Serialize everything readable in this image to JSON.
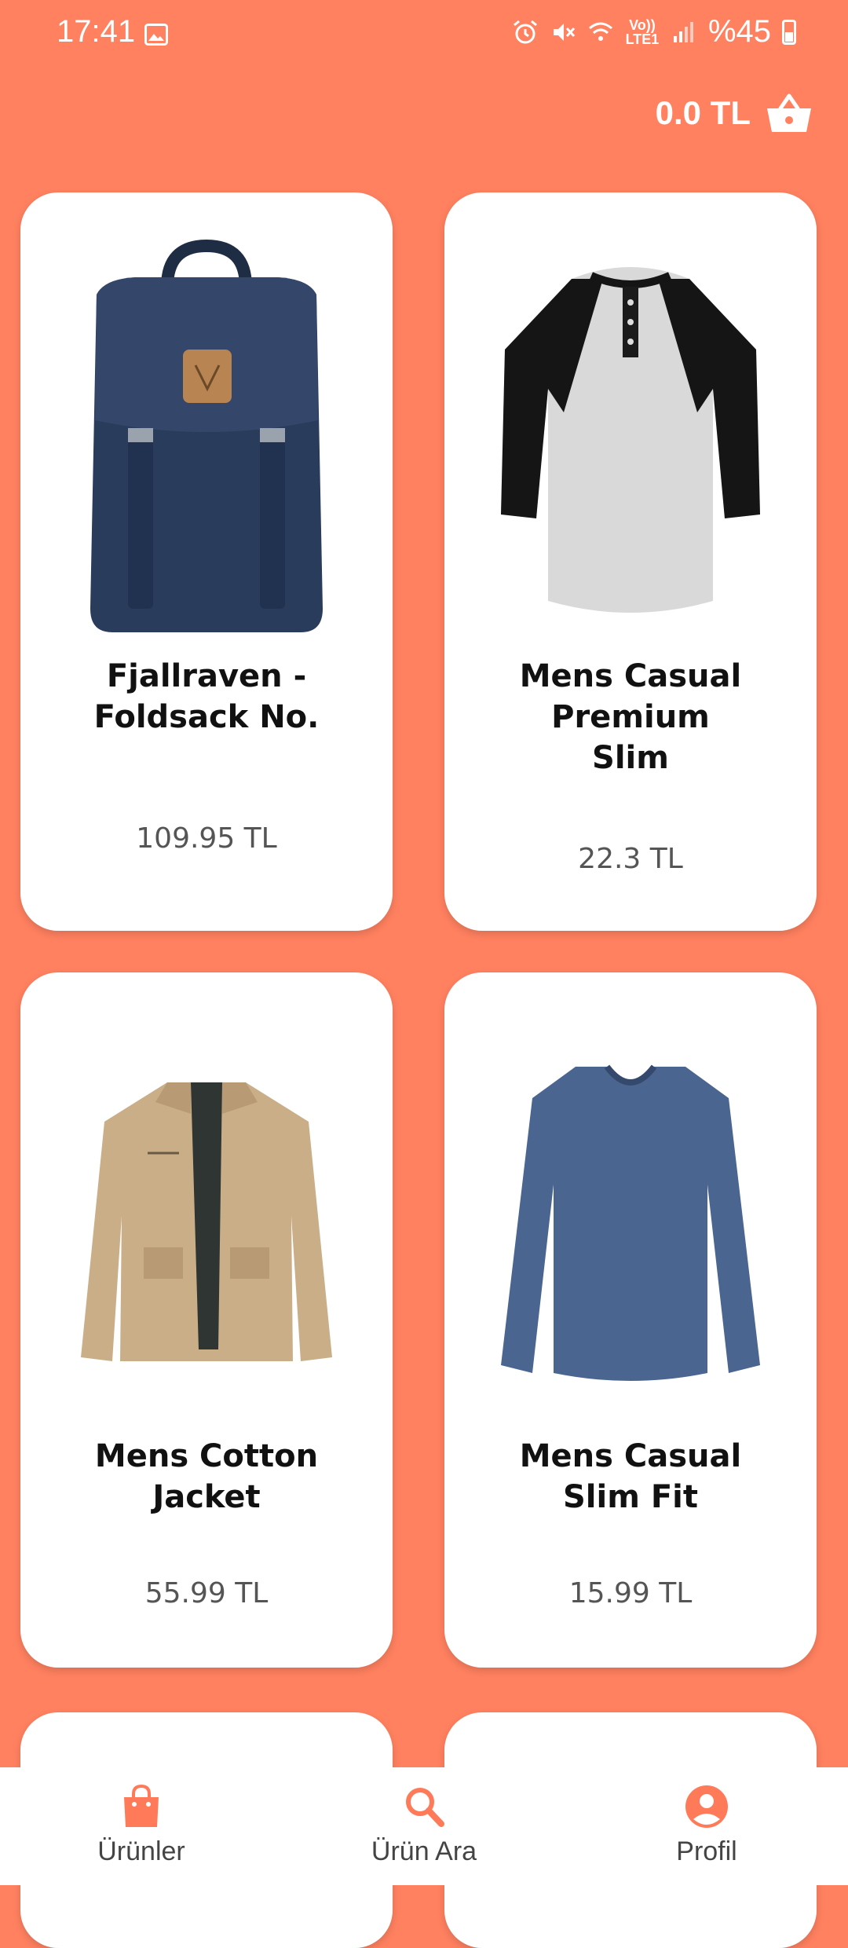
{
  "status_bar": {
    "time": "17:41",
    "network_label": "Vo)) LTE1",
    "battery": "%45",
    "icons": [
      "image-icon",
      "alarm-icon",
      "mute-icon",
      "wifi-icon",
      "signal-icon",
      "battery-icon"
    ]
  },
  "header": {
    "cart_total": "0.0 TL",
    "cart_icon": "basket-icon"
  },
  "products": [
    {
      "title": "Fjallraven - Foldsack No.",
      "price": "109.95 TL",
      "image": "backpack"
    },
    {
      "title": "Mens Casual Premium Slim",
      "price": "22.3 TL",
      "image": "raglan-shirt"
    },
    {
      "title": "Mens Cotton Jacket",
      "price": "55.99 TL",
      "image": "jacket"
    },
    {
      "title": "Mens Casual Slim Fit",
      "price": "15.99 TL",
      "image": "long-sleeve-shirt"
    }
  ],
  "bottom_nav": [
    {
      "label": "Ürünler",
      "icon": "shopping-bag-icon",
      "active": true
    },
    {
      "label": "Ürün Ara",
      "icon": "search-icon",
      "active": false
    },
    {
      "label": "Profil",
      "icon": "account-circle-icon",
      "active": false
    }
  ],
  "colors": {
    "background": "#FF8160",
    "accent": "#FF7A59",
    "card": "#FFFFFF"
  }
}
